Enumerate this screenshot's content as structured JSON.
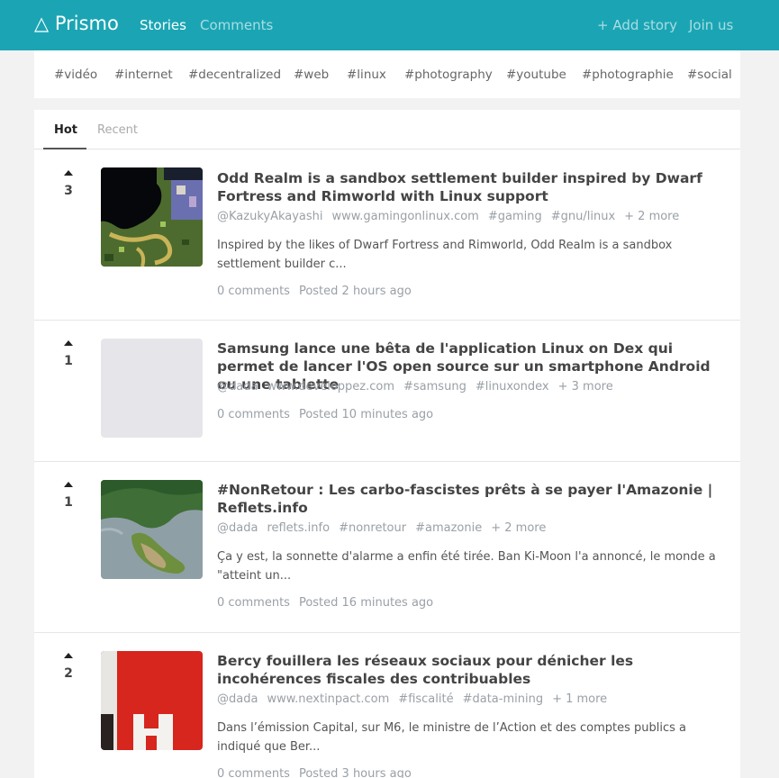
{
  "navbar": {
    "brand": "△ Prismo",
    "stories": "Stories",
    "comments": "Comments",
    "add_story": "+ Add story",
    "join_us": "Join us"
  },
  "tags": [
    "#vidéo",
    "#internet",
    "#decentralized",
    "#web",
    "#linux",
    "#photography",
    "#youtube",
    "#photographie",
    "#social"
  ],
  "tabs": {
    "hot": "Hot",
    "recent": "Recent"
  },
  "stories": [
    {
      "votes": "3",
      "title": "Odd Realm is a sandbox settlement builder inspired by Dwarf Fortress and Rimworld with Linux support",
      "meta": [
        "@KazukyAkayashi",
        "www.gamingonlinux.com",
        "#gaming",
        "#gnu/linux",
        "+ 2 more"
      ],
      "excerpt": "Inspired by the likes of Dwarf Fortress and Rimworld, Odd Realm is a sandbox settlement builder c...",
      "comments": "0 comments",
      "posted": "Posted 2 hours ago"
    },
    {
      "votes": "1",
      "title": "Samsung lance une bêta de l'application Linux on Dex qui permet de lancer l'OS open source sur un smartphone Android ou une tablette",
      "meta": [
        "@dada",
        "www.developpez.com",
        "#samsung",
        "#linuxondex",
        "+ 3 more"
      ],
      "excerpt": "",
      "comments": "0 comments",
      "posted": "Posted 10 minutes ago"
    },
    {
      "votes": "1",
      "title": "#NonRetour : Les carbo-fascistes prêts à se payer l'Amazonie | Reflets.info",
      "meta": [
        "@dada",
        "reflets.info",
        "#nonretour",
        "#amazonie",
        "+ 2 more"
      ],
      "excerpt": "Ça y est, la sonnette d'alarme a enfin été tirée. Ban Ki-Moon l'a annoncé, le monde a \"atteint un...",
      "comments": "0 comments",
      "posted": "Posted 16 minutes ago"
    },
    {
      "votes": "2",
      "title": "Bercy fouillera les réseaux sociaux pour dénicher les incohérences fiscales des contribuables",
      "meta": [
        "@dada",
        "www.nextinpact.com",
        "#fiscalité",
        "#data-mining",
        "+ 1 more"
      ],
      "excerpt": "Dans l’émission Capital, sur M6, le ministre de l’Action et des comptes publics a indiqué que Ber...",
      "comments": "0 comments",
      "posted": "Posted 3 hours ago"
    }
  ],
  "icons": {
    "upvote": "upvote-arrow-icon"
  },
  "colors": {
    "navbar": "#1ba5b4",
    "thumb_placeholder": "#e6e6ea"
  }
}
